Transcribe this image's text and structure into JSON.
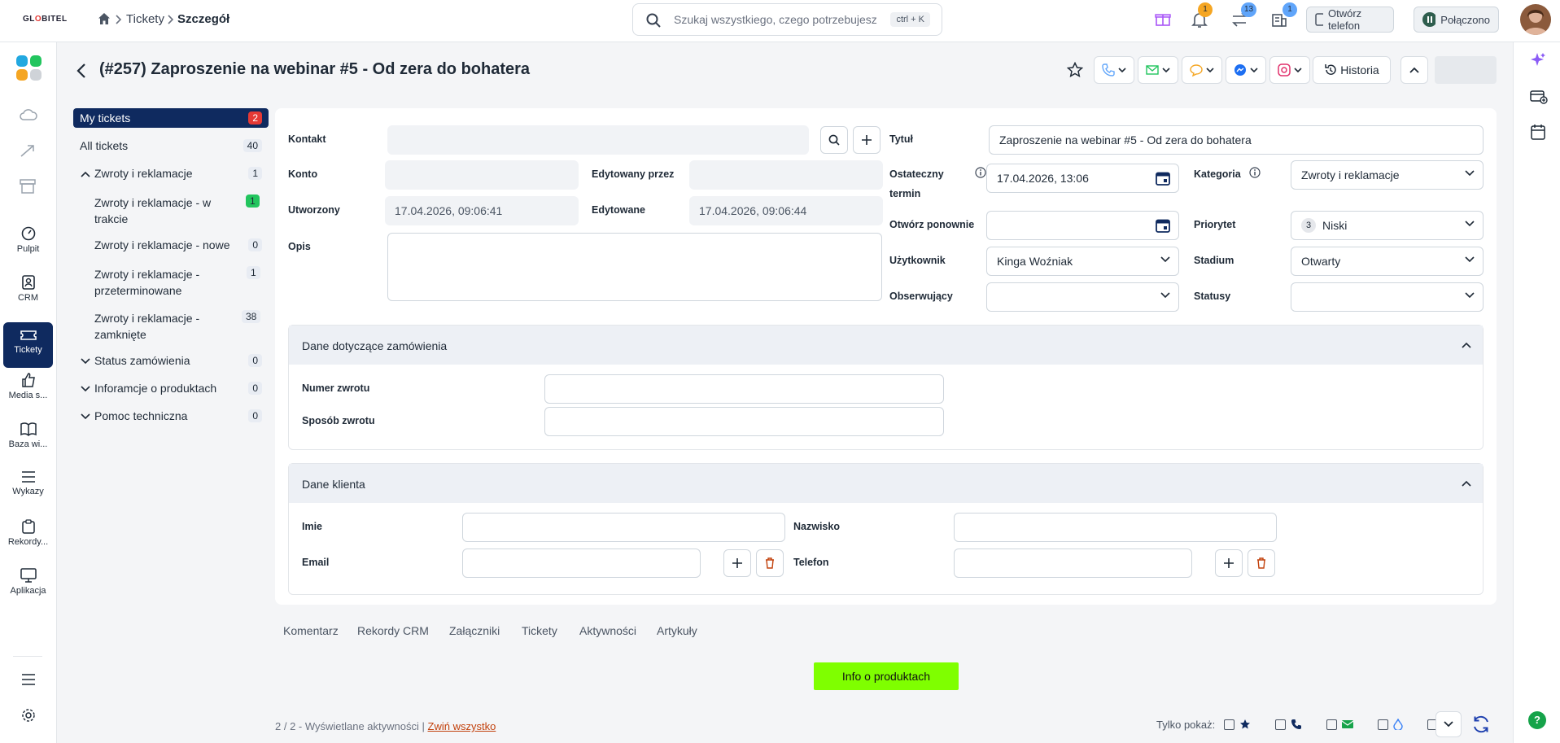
{
  "app": {
    "logo_text_pre": "GL",
    "logo_text_o": "O",
    "logo_text_post": "BITEL"
  },
  "breadcrumb": {
    "parent": "Tickety",
    "current": "Szczegół"
  },
  "search": {
    "placeholder": "Szukaj wszystkiego, czego potrzebujesz",
    "shortcut": "ctrl + K"
  },
  "topbar": {
    "notif_count": "1",
    "transfer_count": "13",
    "building_count": "1",
    "open_phone": "Otwórz telefon",
    "connected": "Połączono"
  },
  "rail": {
    "items": [
      "Pulpit",
      "CRM",
      "Tickety",
      "Media s...",
      "Baza wi...",
      "Wykazy",
      "Rekordy...",
      "Aplikacja"
    ]
  },
  "header": {
    "title": "(#257) Zaproszenie na webinar #5 - Od zera do bohatera",
    "history": "Historia"
  },
  "tree": {
    "my_tickets": {
      "label": "My tickets",
      "count": "2"
    },
    "all_tickets": {
      "label": "All tickets",
      "count": "40"
    },
    "group1": {
      "label": "Zwroty i reklamacje",
      "count": "1"
    },
    "sub1": {
      "label": "Zwroty i reklamacje - w trakcie",
      "count": "1"
    },
    "sub2": {
      "label": "Zwroty i reklamacje - nowe",
      "count": "0"
    },
    "sub3": {
      "label": "Zwroty i reklamacje - przeterminowane",
      "count": "1"
    },
    "sub4": {
      "label": "Zwroty i reklamacje - zamknięte",
      "count": "38"
    },
    "group2": {
      "label": "Status zamówienia",
      "count": "0"
    },
    "group3": {
      "label": "Inforamcje o produktach",
      "count": "0"
    },
    "group4": {
      "label": "Pomoc techniczna",
      "count": "0"
    }
  },
  "form": {
    "kontakt": "Kontakt",
    "konto": "Konto",
    "edytowany_przez": "Edytowany przez",
    "utworzony": "Utworzony",
    "utworzony_val": "17.04.2026, 09:06:41",
    "edytowane": "Edytowane",
    "edytowane_val": "17.04.2026, 09:06:44",
    "opis": "Opis",
    "tytul": "Tytuł",
    "tytul_val": "Zaproszenie na webinar #5 - Od zera do bohatera",
    "termin_1": "Ostateczny",
    "termin_2": "termin",
    "termin_val": "17.04.2026, 13:06",
    "kategoria": "Kategoria",
    "kategoria_val": "Zwroty i reklamacje",
    "otworz": "Otwórz ponownie",
    "priorytet": "Priorytet",
    "priorytet_num": "3",
    "priorytet_val": "Niski",
    "uzytkownik": "Użytkownik",
    "uzytkownik_val": "Kinga Woźniak",
    "stadium": "Stadium",
    "stadium_val": "Otwarty",
    "obserwujacy": "Obserwujący",
    "statusy": "Statusy"
  },
  "order": {
    "title": "Dane dotyczące zamówienia",
    "numer": "Numer zwrotu",
    "sposob": "Sposób zwrotu"
  },
  "client": {
    "title": "Dane klienta",
    "imie": "Imie",
    "nazwisko": "Nazwisko",
    "email": "Email",
    "telefon": "Telefon"
  },
  "tabs": [
    "Komentarz",
    "Rekordy CRM",
    "Załączniki",
    "Tickety",
    "Aktywności",
    "Artykuły"
  ],
  "info_button": "Info o produktach",
  "footer": {
    "activities": "2 / 2 - Wyświetlane aktywności |",
    "collapse": "Zwiń wszystko",
    "only_show": "Tylko pokaż:"
  },
  "colors": {
    "brand_navy": "#0f2a5f",
    "accent_green": "#7fff00",
    "badge_red": "#e53935",
    "badge_green": "#22c55e"
  }
}
